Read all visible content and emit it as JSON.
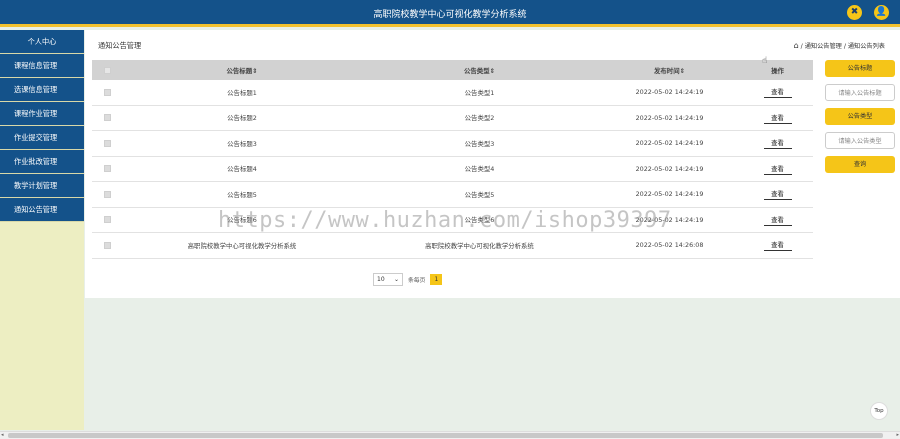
{
  "header": {
    "title": "高职院校教学中心可视化教学分析系统",
    "icon_left": "✖",
    "icon_right": "👤"
  },
  "sidebar": {
    "items": [
      {
        "label": "个人中心"
      },
      {
        "label": "课程信息管理"
      },
      {
        "label": "选课信息管理"
      },
      {
        "label": "课程作业管理"
      },
      {
        "label": "作业提交管理"
      },
      {
        "label": "作业批改管理"
      },
      {
        "label": "教学计划管理"
      },
      {
        "label": "通知公告管理"
      }
    ]
  },
  "main": {
    "title": "通知公告管理",
    "breadcrumb": {
      "home_icon": "⌂",
      "sep1": "/",
      "level1": "通知公告管理",
      "sep2": "/",
      "level2": "通知公告列表"
    }
  },
  "table": {
    "headers": {
      "title": "公告标题⇕",
      "type": "公告类型⇕",
      "date": "发布时间⇕",
      "action": "操作"
    },
    "rows": [
      {
        "title": "公告标题1",
        "type": "公告类型1",
        "date": "2022-05-02 14:24:19",
        "action": "查看"
      },
      {
        "title": "公告标题2",
        "type": "公告类型2",
        "date": "2022-05-02 14:24:19",
        "action": "查看"
      },
      {
        "title": "公告标题3",
        "type": "公告类型3",
        "date": "2022-05-02 14:24:19",
        "action": "查看"
      },
      {
        "title": "公告标题4",
        "type": "公告类型4",
        "date": "2022-05-02 14:24:19",
        "action": "查看"
      },
      {
        "title": "公告标题5",
        "type": "公告类型5",
        "date": "2022-05-02 14:24:19",
        "action": "查看"
      },
      {
        "title": "公告标题6",
        "type": "公告类型6",
        "date": "2022-05-02 14:24:19",
        "action": "查看"
      },
      {
        "title": "高职院校教学中心可视化教学分析系统",
        "type": "高职院校教学中心可视化教学分析系统",
        "date": "2022-05-02 14:26:08",
        "action": "查看"
      }
    ]
  },
  "pagination": {
    "page_size": "10",
    "label": "条每页",
    "current_page": "1"
  },
  "search_panel": {
    "title_label": "公告标题",
    "title_placeholder": "请输入公告标题",
    "type_label": "公告类型",
    "type_placeholder": "请输入公告类型",
    "query_button": "查询"
  },
  "watermark": "https://www.huzhan.com/ishop39397",
  "top_button": "Top",
  "colors": {
    "header_bg": "#14528a",
    "accent": "#f5c518",
    "sidebar_bg": "#edeec2"
  }
}
